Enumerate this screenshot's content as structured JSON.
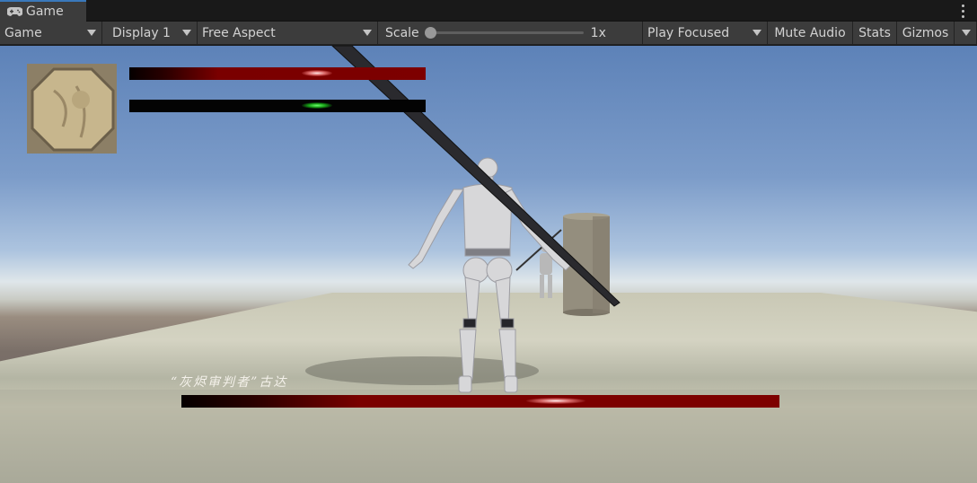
{
  "tab": {
    "label": "Game",
    "icon": "gamepad-icon",
    "menu_icon": "kebab-menu-icon"
  },
  "toolbar": {
    "game_dropdown": "Game",
    "display_dropdown": "Display 1",
    "aspect_dropdown": "Free Aspect",
    "scale_label": "Scale",
    "scale_value": "1x",
    "scale_slider_fraction": 0.0,
    "play_focused": "Play Focused",
    "mute_audio": "Mute Audio",
    "stats": "Stats",
    "gizmos": "Gizmos"
  },
  "hud": {
    "player_portrait": "stone-portrait",
    "player_health_fill": 1.0,
    "player_stamina_fill": 1.0,
    "boss_name": "“灰烬审判者”古达",
    "boss_health_fill": 1.0,
    "colors": {
      "health": "#7d0000",
      "stamina_glow": "#1ee01e",
      "health_glow": "#ffd0d0"
    }
  }
}
